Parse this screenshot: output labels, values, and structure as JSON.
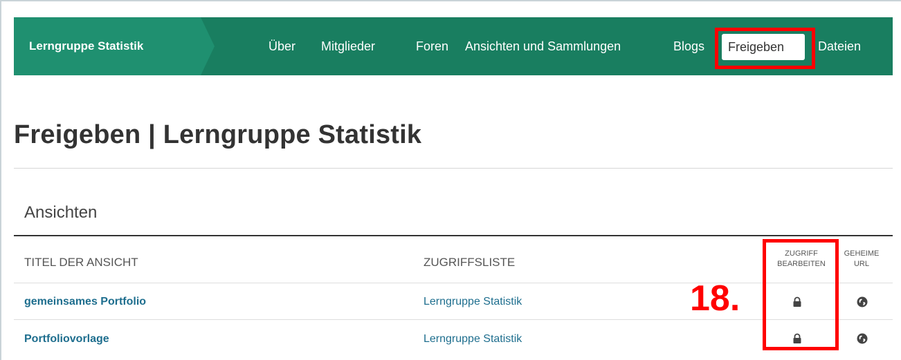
{
  "navbar": {
    "brand": "Lerngruppe Statistik",
    "items": [
      {
        "label": "Über"
      },
      {
        "label": "Mitglieder"
      },
      {
        "label": "Foren"
      },
      {
        "label": "Ansichten und Sammlungen"
      },
      {
        "label": "Blogs"
      },
      {
        "label": "Freigeben",
        "active": true
      },
      {
        "label": "Dateien"
      }
    ]
  },
  "page": {
    "title": "Freigeben | Lerngruppe Statistik",
    "section": "Ansichten"
  },
  "table": {
    "headers": {
      "title": "TITEL DER ANSICHT",
      "access_list": "ZUGRIFFSLISTE",
      "edit_access_line1": "ZUGRIFF",
      "edit_access_line2": "BEARBEITEN",
      "secret_url_line1": "GEHEIME",
      "secret_url_line2": "URL"
    },
    "rows": [
      {
        "title": "gemeinsames Portfolio",
        "access": "Lerngruppe Statistik",
        "edit_icon": "lock-icon",
        "url_icon": "globe-icon"
      },
      {
        "title": "Portfoliovorlage",
        "access": "Lerngruppe Statistik",
        "edit_icon": "lock-icon",
        "url_icon": "globe-icon"
      }
    ]
  },
  "annotation": {
    "label": "18.",
    "color": "#ff0000"
  },
  "colors": {
    "navbar": "#197e60",
    "brand_bg": "#1f9070",
    "link": "#1e6e8e"
  }
}
